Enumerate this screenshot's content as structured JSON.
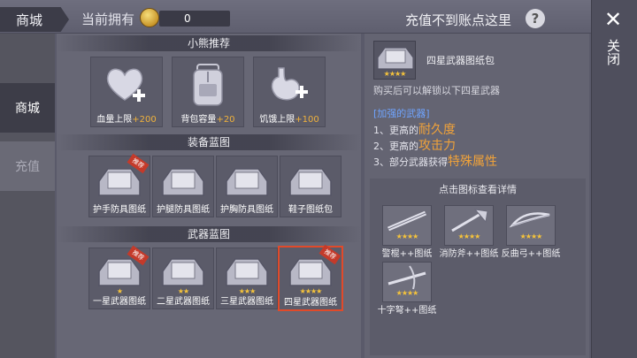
{
  "header": {
    "title": "商城",
    "owned_label": "当前拥有",
    "coin_count": "0",
    "recharge_text": "充值不到账点这里",
    "help_glyph": "?"
  },
  "close": {
    "glyph": "✕",
    "label": "关闭"
  },
  "sidebar": {
    "items": [
      {
        "label": "商城"
      },
      {
        "label": "充值"
      }
    ]
  },
  "sections": {
    "recommend": "小熊推荐",
    "gear_blueprints": "装备蓝图",
    "weapon_blueprints": "武器蓝图"
  },
  "recommend_items": [
    {
      "name": "血量上限",
      "bonus": "+200",
      "icon": "heart-plus-icon"
    },
    {
      "name": "背包容量",
      "bonus": "+20",
      "icon": "backpack-icon"
    },
    {
      "name": "饥饿上限",
      "bonus": "+100",
      "icon": "stomach-plus-icon"
    }
  ],
  "gear_items": [
    {
      "name": "护手防具图纸",
      "badge": "推荐"
    },
    {
      "name": "护腿防具图纸",
      "badge": ""
    },
    {
      "name": "护胸防具图纸",
      "badge": ""
    },
    {
      "name": "鞋子图纸包",
      "badge": ""
    }
  ],
  "weapon_items": [
    {
      "name": "一星武器图纸",
      "badge": "推荐",
      "stars": "★"
    },
    {
      "name": "二星武器图纸",
      "badge": "",
      "stars": "★★"
    },
    {
      "name": "三星武器图纸",
      "badge": "",
      "stars": "★★★"
    },
    {
      "name": "四星武器图纸",
      "badge": "推荐",
      "stars": "★★★★",
      "selected": true
    }
  ],
  "detail": {
    "name": "四星武器图纸包",
    "stars": "★★★★",
    "desc": "购买后可以解锁以下四星武器",
    "enhanced_title": "[加强的武器]",
    "lines": [
      {
        "prefix": "1、更高的",
        "highlight": "耐久度"
      },
      {
        "prefix": "2、更高的",
        "highlight": "攻击力"
      },
      {
        "prefix": "3、部分武器获得",
        "highlight": "特殊属性"
      }
    ],
    "click_hint": "点击图标查看详情",
    "weapons": [
      {
        "name": "警棍++图纸",
        "stars": "★★★★"
      },
      {
        "name": "消防斧++图纸",
        "stars": "★★★★"
      },
      {
        "name": "反曲弓++图纸",
        "stars": "★★★★"
      },
      {
        "name": "十字弩++图纸",
        "stars": "★★★★"
      }
    ]
  },
  "colors": {
    "accent": "#f0a23a",
    "enhanced_title": "#6fa4ff",
    "selected_border": "#e14a2a",
    "star": "#f5c33b"
  }
}
